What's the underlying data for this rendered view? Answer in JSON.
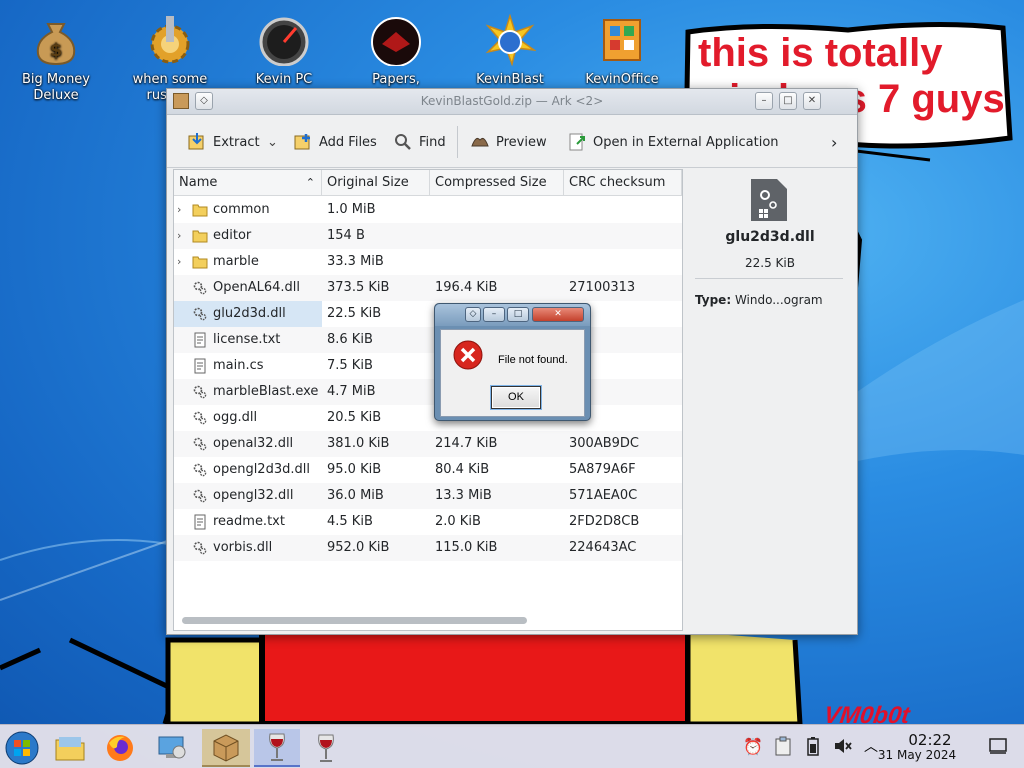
{
  "desktop": {
    "icons": [
      {
        "label": "Big Money\nDeluxe",
        "icon": "money-bag-icon"
      },
      {
        "label": "when some\nrussian",
        "icon": "gear-icon"
      },
      {
        "label": "Kevin PC",
        "icon": "gauge-icon"
      },
      {
        "label": "Papers, Please",
        "icon": "papers-please-icon"
      },
      {
        "label": "KevinBlast",
        "icon": "marble-blast-icon"
      },
      {
        "label": "KevinOffice",
        "icon": "office-icon"
      }
    ],
    "bubble_text": "this is totally windows 7 guys",
    "signature": "VM0b0t"
  },
  "ark": {
    "title": "KevinBlastGold.zip — Ark <2>",
    "toolbar": {
      "extract": "Extract",
      "add_files": "Add Files",
      "find": "Find",
      "preview": "Preview",
      "open_external": "Open in External Application"
    },
    "columns": [
      "Name",
      "Original Size",
      "Compressed Size",
      "CRC checksum"
    ],
    "rows": [
      {
        "name": "common",
        "size": "1.0 MiB",
        "compressed": "",
        "crc": "",
        "type": "folder"
      },
      {
        "name": "editor",
        "size": "154 B",
        "compressed": "",
        "crc": "",
        "type": "folder"
      },
      {
        "name": "marble",
        "size": "33.3 MiB",
        "compressed": "",
        "crc": "",
        "type": "folder"
      },
      {
        "name": "OpenAL64.dll",
        "size": "373.5 KiB",
        "compressed": "196.4 KiB",
        "crc": "27100313",
        "type": "dll"
      },
      {
        "name": "glu2d3d.dll",
        "size": "22.5 KiB",
        "compressed": "",
        "crc": "",
        "type": "dll"
      },
      {
        "name": "license.txt",
        "size": "8.6 KiB",
        "compressed": "",
        "crc": "",
        "type": "txt"
      },
      {
        "name": "main.cs",
        "size": "7.5 KiB",
        "compressed": "",
        "crc": "",
        "type": "txt"
      },
      {
        "name": "marbleBlast.exe",
        "size": "4.7 MiB",
        "compressed": "",
        "crc": "",
        "type": "dll"
      },
      {
        "name": "ogg.dll",
        "size": "20.5 KiB",
        "compressed": "",
        "crc": "",
        "type": "dll"
      },
      {
        "name": "openal32.dll",
        "size": "381.0 KiB",
        "compressed": "214.7 KiB",
        "crc": "300AB9DC",
        "type": "dll"
      },
      {
        "name": "opengl2d3d.dll",
        "size": "95.0 KiB",
        "compressed": "80.4 KiB",
        "crc": "5A879A6F",
        "type": "dll"
      },
      {
        "name": "opengl32.dll",
        "size": "36.0 MiB",
        "compressed": "13.3 MiB",
        "crc": "571AEA0C",
        "type": "dll"
      },
      {
        "name": "readme.txt",
        "size": "4.5 KiB",
        "compressed": "2.0 KiB",
        "crc": "2FD2D8CB",
        "type": "txt"
      },
      {
        "name": "vorbis.dll",
        "size": "952.0 KiB",
        "compressed": "115.0 KiB",
        "crc": "224643AC",
        "type": "dll"
      }
    ],
    "details": {
      "name": "glu2d3d.dll",
      "size": "22.5 KiB",
      "type_label": "Type:",
      "type_value": "Windo...ogram"
    }
  },
  "dialog": {
    "message": "File not found.",
    "ok": "OK"
  },
  "taskbar": {
    "time": "02:22",
    "date": "31 May 2024"
  },
  "colors": {
    "error_red": "#d7261e",
    "bubble_text": "#e21b2b",
    "selection": "#d6e6f5"
  }
}
